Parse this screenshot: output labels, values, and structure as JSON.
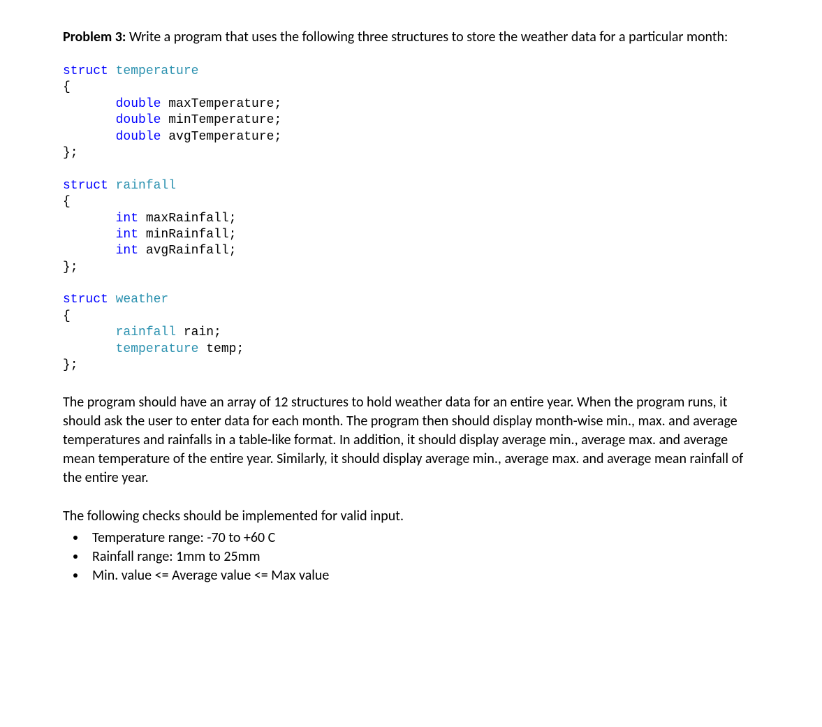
{
  "header": {
    "label": "Problem 3:",
    "text": " Write a program that uses the following three structures to store the weather data for a particular month:"
  },
  "code": {
    "struct1": {
      "kw": "struct",
      "name": "temperature",
      "open": "{",
      "line1_type": "double",
      "line1_ident": " maxTemperature;",
      "line2_type": "double",
      "line2_ident": " minTemperature;",
      "line3_type": "double",
      "line3_ident": " avgTemperature;",
      "close": "};"
    },
    "struct2": {
      "kw": "struct",
      "name": "rainfall",
      "open": "{",
      "line1_type": "int",
      "line1_ident": " maxRainfall;",
      "line2_type": "int",
      "line2_ident": " minRainfall;",
      "line3_type": "int",
      "line3_ident": " avgRainfall;",
      "close": "};"
    },
    "struct3": {
      "kw": "struct",
      "name": "weather",
      "open": "{",
      "line1_type": "rainfall",
      "line1_ident": " rain;",
      "line2_type": "temperature",
      "line2_ident": " temp;",
      "close": "};"
    }
  },
  "para1": "The program should have an array of 12 structures to hold weather data for an entire year. When the program runs, it should ask the user to enter data for each month. The program then should display month-wise min., max. and average temperatures and rainfalls in a table-like format. In addition, it should display average min., average max. and average mean temperature of the entire year. Similarly, it should display average min., average max. and average mean rainfall of the entire year.",
  "checks_intro": "The following checks should be implemented for valid input.",
  "bullets": [
    "Temperature range: -70 to +60 C",
    "Rainfall range: 1mm to 25mm",
    "Min. value <= Average value <= Max value"
  ]
}
